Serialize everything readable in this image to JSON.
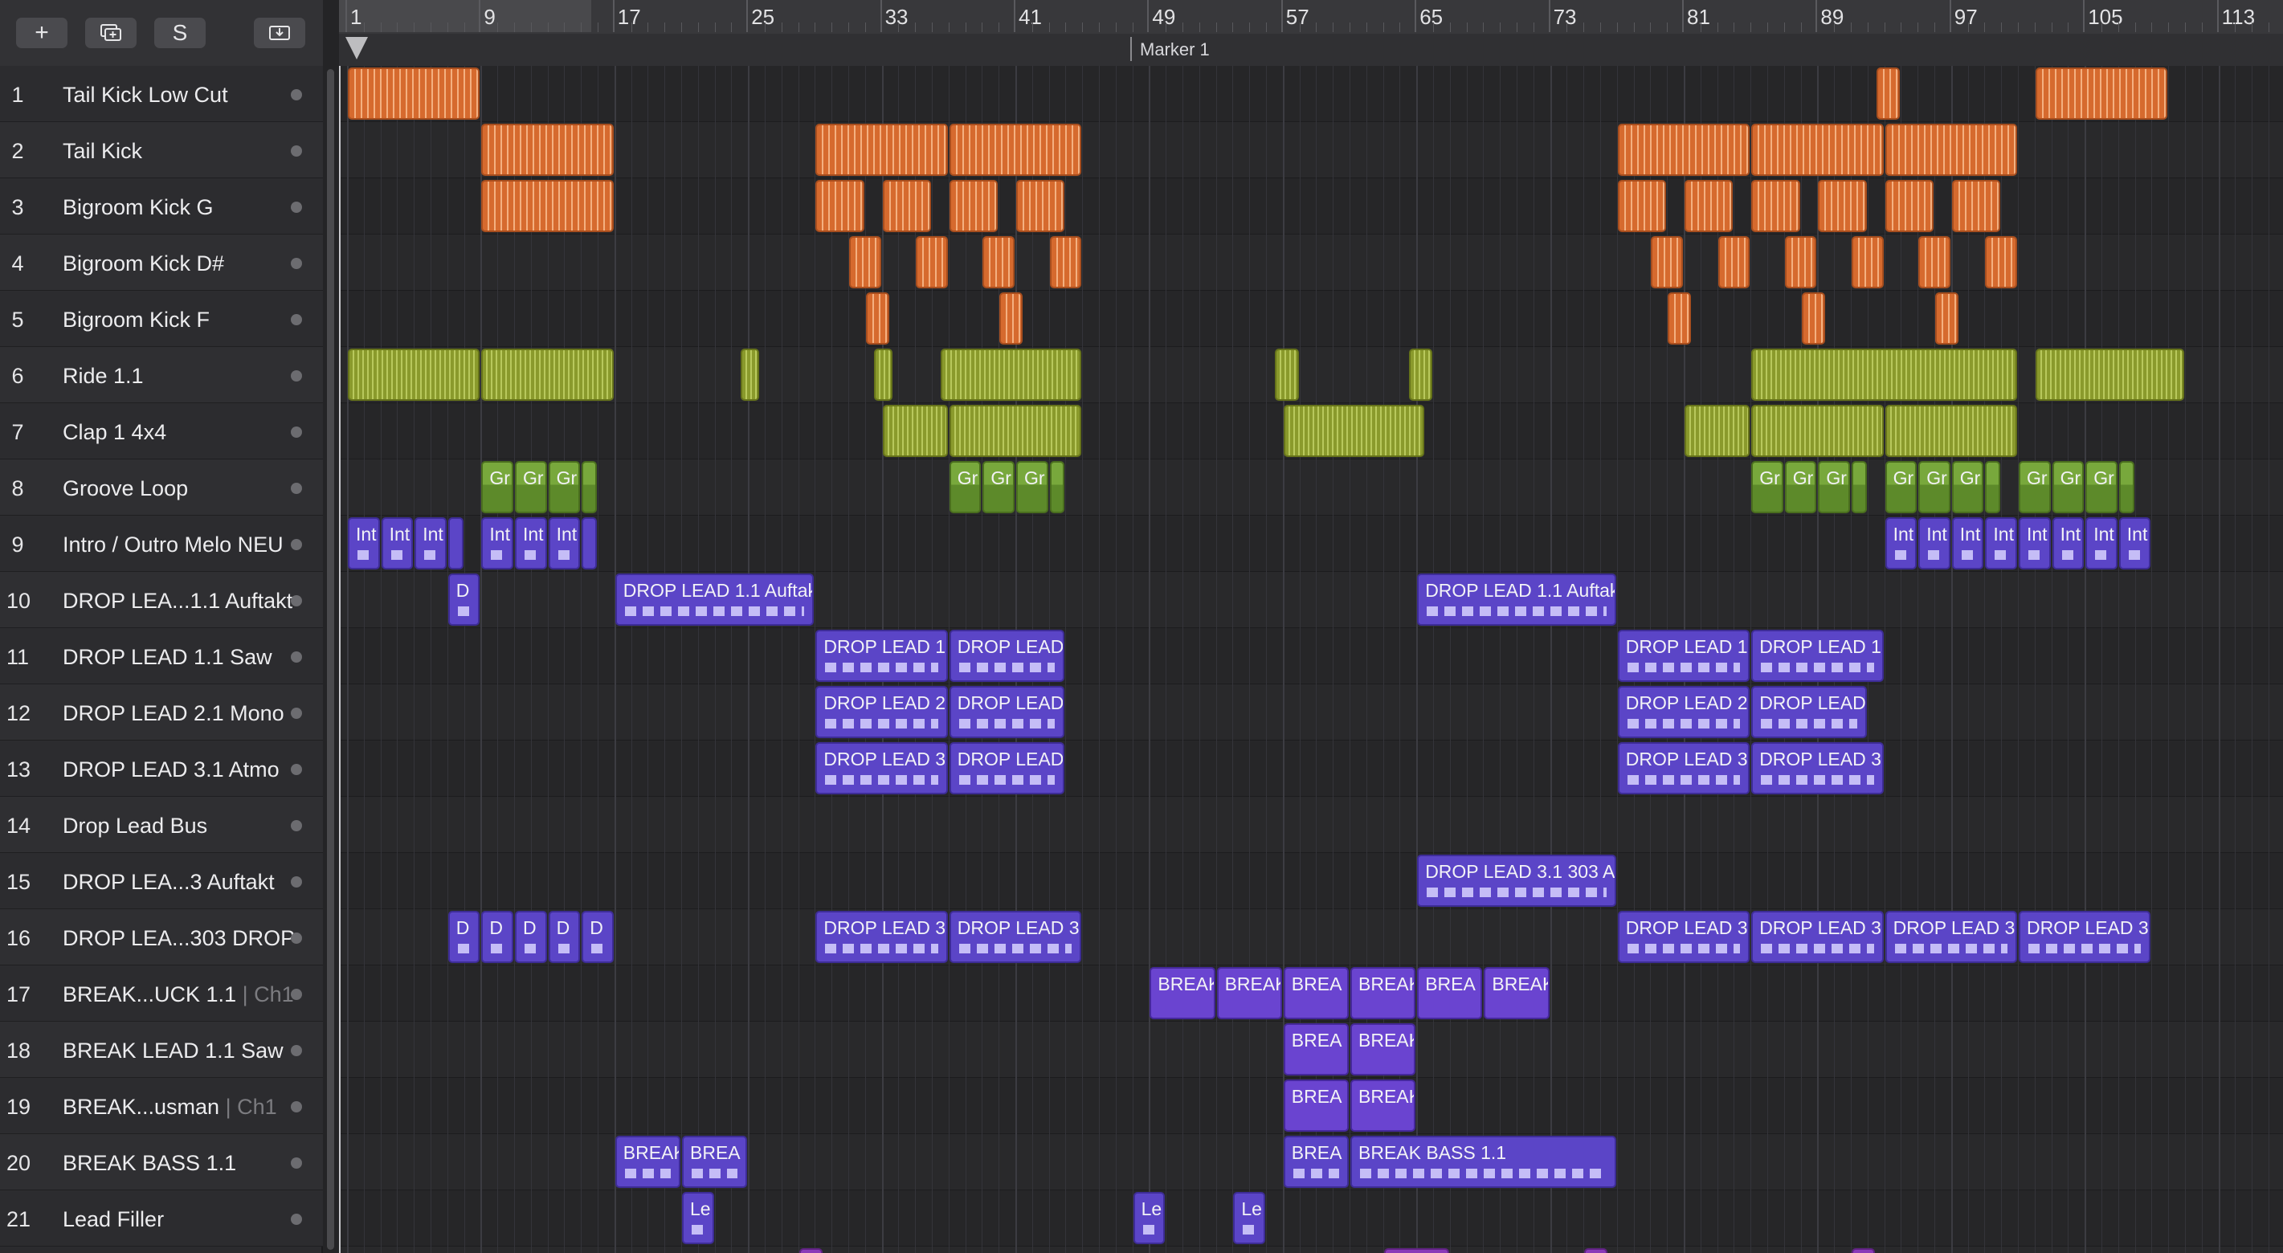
{
  "toolbar": {
    "add_track_icon": "plus-icon",
    "add_track_label": "+",
    "duplicate_icon": "duplicate-track-icon",
    "solo_label": "S",
    "download_icon": "download-icon"
  },
  "ruler": {
    "bars": [
      "1",
      "9",
      "17",
      "25",
      "33",
      "41",
      "49",
      "57",
      "65",
      "73",
      "81",
      "89",
      "97",
      "105",
      "113"
    ],
    "marker_label": "Marker 1"
  },
  "tracks": [
    {
      "num": "1",
      "name": "Tail Kick Low Cut",
      "chan": ""
    },
    {
      "num": "2",
      "name": "Tail Kick",
      "chan": ""
    },
    {
      "num": "3",
      "name": "Bigroom Kick G",
      "chan": ""
    },
    {
      "num": "4",
      "name": "Bigroom Kick D#",
      "chan": ""
    },
    {
      "num": "5",
      "name": "Bigroom Kick F",
      "chan": ""
    },
    {
      "num": "6",
      "name": "Ride 1.1",
      "chan": ""
    },
    {
      "num": "7",
      "name": "Clap 1 4x4",
      "chan": ""
    },
    {
      "num": "8",
      "name": "Groove Loop",
      "chan": ""
    },
    {
      "num": "9",
      "name": "Intro / Outro Melo NEU",
      "chan": ""
    },
    {
      "num": "10",
      "name": "DROP LEA...1.1 Auftakt",
      "chan": ""
    },
    {
      "num": "11",
      "name": "DROP LEAD 1.1 Saw",
      "chan": ""
    },
    {
      "num": "12",
      "name": "DROP LEAD 2.1 Mono",
      "chan": ""
    },
    {
      "num": "13",
      "name": "DROP LEAD 3.1 Atmo",
      "chan": ""
    },
    {
      "num": "14",
      "name": "Drop Lead Bus",
      "chan": ""
    },
    {
      "num": "15",
      "name": "DROP LEA...3 Auftakt",
      "chan": ""
    },
    {
      "num": "16",
      "name": "DROP LEA...303 DROP",
      "chan": ""
    },
    {
      "num": "17",
      "name": "BREAK...UCK 1.1",
      "chan": " | Ch1"
    },
    {
      "num": "18",
      "name": "BREAK LEAD 1.1 Saw",
      "chan": ""
    },
    {
      "num": "19",
      "name": "BREAK...usman",
      "chan": " | Ch1"
    },
    {
      "num": "20",
      "name": "BREAK BASS 1.1",
      "chan": ""
    },
    {
      "num": "21",
      "name": "Lead Filler",
      "chan": ""
    }
  ],
  "regions": [
    {
      "track": 0,
      "bar": 1,
      "len": 8,
      "style": "orange",
      "label": ""
    },
    {
      "track": 0,
      "bar": 92.5,
      "len": 1.5,
      "style": "orange",
      "label": ""
    },
    {
      "track": 0,
      "bar": 102,
      "len": 8,
      "style": "orange",
      "label": ""
    },
    {
      "track": 1,
      "bar": 9,
      "len": 8,
      "style": "orange",
      "label": ""
    },
    {
      "track": 1,
      "bar": 29,
      "len": 8,
      "style": "orange",
      "label": ""
    },
    {
      "track": 1,
      "bar": 37,
      "len": 8,
      "style": "orange",
      "label": ""
    },
    {
      "track": 1,
      "bar": 77,
      "len": 8,
      "style": "orange",
      "label": ""
    },
    {
      "track": 1,
      "bar": 85,
      "len": 8,
      "style": "orange",
      "label": ""
    },
    {
      "track": 1,
      "bar": 93,
      "len": 8,
      "style": "orange",
      "label": ""
    },
    {
      "track": 2,
      "bar": 9,
      "len": 8,
      "style": "orange",
      "label": ""
    },
    {
      "track": 2,
      "bar": 29,
      "len": 3,
      "style": "orange",
      "label": ""
    },
    {
      "track": 2,
      "bar": 33,
      "len": 3,
      "style": "orange",
      "label": ""
    },
    {
      "track": 2,
      "bar": 37,
      "len": 3,
      "style": "orange",
      "label": ""
    },
    {
      "track": 2,
      "bar": 41,
      "len": 3,
      "style": "orange",
      "label": ""
    },
    {
      "track": 2,
      "bar": 77,
      "len": 3,
      "style": "orange",
      "label": ""
    },
    {
      "track": 2,
      "bar": 81,
      "len": 3,
      "style": "orange",
      "label": ""
    },
    {
      "track": 2,
      "bar": 85,
      "len": 3,
      "style": "orange",
      "label": ""
    },
    {
      "track": 2,
      "bar": 89,
      "len": 3,
      "style": "orange",
      "label": ""
    },
    {
      "track": 2,
      "bar": 93,
      "len": 3,
      "style": "orange",
      "label": ""
    },
    {
      "track": 2,
      "bar": 97,
      "len": 3,
      "style": "orange",
      "label": ""
    },
    {
      "track": 3,
      "bar": 31,
      "len": 2,
      "style": "orange",
      "label": ""
    },
    {
      "track": 3,
      "bar": 35,
      "len": 2,
      "style": "orange",
      "label": ""
    },
    {
      "track": 3,
      "bar": 39,
      "len": 2,
      "style": "orange",
      "label": ""
    },
    {
      "track": 3,
      "bar": 43,
      "len": 2,
      "style": "orange",
      "label": ""
    },
    {
      "track": 3,
      "bar": 79,
      "len": 2,
      "style": "orange",
      "label": ""
    },
    {
      "track": 3,
      "bar": 83,
      "len": 2,
      "style": "orange",
      "label": ""
    },
    {
      "track": 3,
      "bar": 87,
      "len": 2,
      "style": "orange",
      "label": ""
    },
    {
      "track": 3,
      "bar": 91,
      "len": 2,
      "style": "orange",
      "label": ""
    },
    {
      "track": 3,
      "bar": 95,
      "len": 2,
      "style": "orange",
      "label": ""
    },
    {
      "track": 3,
      "bar": 99,
      "len": 2,
      "style": "orange",
      "label": ""
    },
    {
      "track": 4,
      "bar": 32,
      "len": 1.5,
      "style": "orange",
      "label": ""
    },
    {
      "track": 4,
      "bar": 40,
      "len": 1.5,
      "style": "orange",
      "label": ""
    },
    {
      "track": 4,
      "bar": 80,
      "len": 1.5,
      "style": "orange",
      "label": ""
    },
    {
      "track": 4,
      "bar": 88,
      "len": 1.5,
      "style": "orange",
      "label": ""
    },
    {
      "track": 4,
      "bar": 96,
      "len": 1.5,
      "style": "orange",
      "label": ""
    },
    {
      "track": 5,
      "bar": 1,
      "len": 8,
      "style": "olive",
      "label": ""
    },
    {
      "track": 5,
      "bar": 9,
      "len": 8,
      "style": "olive",
      "label": ""
    },
    {
      "track": 5,
      "bar": 24.5,
      "len": 1.2,
      "style": "olive",
      "label": ""
    },
    {
      "track": 5,
      "bar": 32.5,
      "len": 1.2,
      "style": "olive",
      "label": ""
    },
    {
      "track": 5,
      "bar": 36.5,
      "len": 8.5,
      "style": "olive",
      "label": ""
    },
    {
      "track": 5,
      "bar": 56.5,
      "len": 1.5,
      "style": "olive",
      "label": ""
    },
    {
      "track": 5,
      "bar": 64.5,
      "len": 1.5,
      "style": "olive",
      "label": ""
    },
    {
      "track": 5,
      "bar": 85,
      "len": 16,
      "style": "olive",
      "label": ""
    },
    {
      "track": 5,
      "bar": 102,
      "len": 9,
      "style": "olive",
      "label": ""
    },
    {
      "track": 6,
      "bar": 33,
      "len": 4,
      "style": "olive",
      "label": ""
    },
    {
      "track": 6,
      "bar": 37,
      "len": 8,
      "style": "olive",
      "label": ""
    },
    {
      "track": 6,
      "bar": 57,
      "len": 8.5,
      "style": "olive",
      "label": ""
    },
    {
      "track": 6,
      "bar": 81,
      "len": 4,
      "style": "olive",
      "label": ""
    },
    {
      "track": 6,
      "bar": 85,
      "len": 8,
      "style": "olive",
      "label": ""
    },
    {
      "track": 6,
      "bar": 93,
      "len": 8,
      "style": "olive",
      "label": ""
    },
    {
      "track": 7,
      "bar": 9,
      "len": 2,
      "style": "green",
      "label": "Gr"
    },
    {
      "track": 7,
      "bar": 11,
      "len": 2,
      "style": "green",
      "label": "Gr"
    },
    {
      "track": 7,
      "bar": 13,
      "len": 2,
      "style": "green",
      "label": "Gr"
    },
    {
      "track": 7,
      "bar": 15,
      "len": 1,
      "style": "green",
      "label": ""
    },
    {
      "track": 7,
      "bar": 37,
      "len": 2,
      "style": "green",
      "label": "Gr"
    },
    {
      "track": 7,
      "bar": 39,
      "len": 2,
      "style": "green",
      "label": "Gr"
    },
    {
      "track": 7,
      "bar": 41,
      "len": 2,
      "style": "green",
      "label": "Gr"
    },
    {
      "track": 7,
      "bar": 43,
      "len": 1,
      "style": "green",
      "label": ""
    },
    {
      "track": 7,
      "bar": 85,
      "len": 2,
      "style": "green",
      "label": "Gr"
    },
    {
      "track": 7,
      "bar": 87,
      "len": 2,
      "style": "green",
      "label": "Gr"
    },
    {
      "track": 7,
      "bar": 89,
      "len": 2,
      "style": "green",
      "label": "Gr"
    },
    {
      "track": 7,
      "bar": 91,
      "len": 1,
      "style": "green",
      "label": ""
    },
    {
      "track": 7,
      "bar": 93,
      "len": 2,
      "style": "green",
      "label": "Gr"
    },
    {
      "track": 7,
      "bar": 95,
      "len": 2,
      "style": "green",
      "label": "Gr"
    },
    {
      "track": 7,
      "bar": 97,
      "len": 2,
      "style": "green",
      "label": "Gr"
    },
    {
      "track": 7,
      "bar": 99,
      "len": 1,
      "style": "green",
      "label": ""
    },
    {
      "track": 7,
      "bar": 101,
      "len": 2,
      "style": "green",
      "label": "Gr"
    },
    {
      "track": 7,
      "bar": 103,
      "len": 2,
      "style": "green",
      "label": "Gr"
    },
    {
      "track": 7,
      "bar": 105,
      "len": 2,
      "style": "green",
      "label": "Gr"
    },
    {
      "track": 7,
      "bar": 107,
      "len": 1,
      "style": "green",
      "label": ""
    },
    {
      "track": 8,
      "bar": 1,
      "len": 2,
      "style": "purple",
      "label": "Int"
    },
    {
      "track": 8,
      "bar": 3,
      "len": 2,
      "style": "purple",
      "label": "Int"
    },
    {
      "track": 8,
      "bar": 5,
      "len": 2,
      "style": "purple",
      "label": "Int"
    },
    {
      "track": 8,
      "bar": 7,
      "len": 1,
      "style": "purple",
      "label": ""
    },
    {
      "track": 8,
      "bar": 9,
      "len": 2,
      "style": "purple",
      "label": "Int"
    },
    {
      "track": 8,
      "bar": 11,
      "len": 2,
      "style": "purple",
      "label": "Int"
    },
    {
      "track": 8,
      "bar": 13,
      "len": 2,
      "style": "purple",
      "label": "Int"
    },
    {
      "track": 8,
      "bar": 15,
      "len": 1,
      "style": "purple",
      "label": ""
    },
    {
      "track": 8,
      "bar": 93,
      "len": 2,
      "style": "purple",
      "label": "Int"
    },
    {
      "track": 8,
      "bar": 95,
      "len": 2,
      "style": "purple",
      "label": "Int"
    },
    {
      "track": 8,
      "bar": 97,
      "len": 2,
      "style": "purple",
      "label": "Int"
    },
    {
      "track": 8,
      "bar": 99,
      "len": 2,
      "style": "purple",
      "label": "Int"
    },
    {
      "track": 8,
      "bar": 101,
      "len": 2,
      "style": "purple",
      "label": "Int"
    },
    {
      "track": 8,
      "bar": 103,
      "len": 2,
      "style": "purple",
      "label": "Int"
    },
    {
      "track": 8,
      "bar": 105,
      "len": 2,
      "style": "purple",
      "label": "Int"
    },
    {
      "track": 8,
      "bar": 107,
      "len": 2,
      "style": "purple",
      "label": "Int"
    },
    {
      "track": 9,
      "bar": 7,
      "len": 2,
      "style": "purple",
      "label": "D"
    },
    {
      "track": 9,
      "bar": 17,
      "len": 12,
      "style": "purple",
      "label": "DROP LEAD 1.1 Auftak"
    },
    {
      "track": 9,
      "bar": 65,
      "len": 12,
      "style": "purple",
      "label": "DROP LEAD 1.1 Auftak"
    },
    {
      "track": 10,
      "bar": 29,
      "len": 8,
      "style": "purple",
      "label": "DROP LEAD 1."
    },
    {
      "track": 10,
      "bar": 37,
      "len": 7,
      "style": "purple",
      "label": "DROP LEAD"
    },
    {
      "track": 10,
      "bar": 77,
      "len": 8,
      "style": "purple",
      "label": "DROP LEAD 1."
    },
    {
      "track": 10,
      "bar": 85,
      "len": 8,
      "style": "purple",
      "label": "DROP LEAD 1."
    },
    {
      "track": 11,
      "bar": 29,
      "len": 8,
      "style": "purple",
      "label": "DROP LEAD 2."
    },
    {
      "track": 11,
      "bar": 37,
      "len": 7,
      "style": "purple",
      "label": "DROP LEAD"
    },
    {
      "track": 11,
      "bar": 77,
      "len": 8,
      "style": "purple",
      "label": "DROP LEAD 2."
    },
    {
      "track": 11,
      "bar": 85,
      "len": 7,
      "style": "purple",
      "label": "DROP LEAD"
    },
    {
      "track": 12,
      "bar": 29,
      "len": 8,
      "style": "purple",
      "label": "DROP LEAD 3."
    },
    {
      "track": 12,
      "bar": 37,
      "len": 7,
      "style": "purple",
      "label": "DROP LEAD"
    },
    {
      "track": 12,
      "bar": 77,
      "len": 8,
      "style": "purple",
      "label": "DROP LEAD 3."
    },
    {
      "track": 12,
      "bar": 85,
      "len": 8,
      "style": "purple",
      "label": "DROP LEAD 3."
    },
    {
      "track": 14,
      "bar": 65,
      "len": 12,
      "style": "purple",
      "label": "DROP LEAD 3.1 303 A"
    },
    {
      "track": 15,
      "bar": 7,
      "len": 2,
      "style": "purple",
      "label": "D"
    },
    {
      "track": 15,
      "bar": 9,
      "len": 2,
      "style": "purple",
      "label": "D"
    },
    {
      "track": 15,
      "bar": 11,
      "len": 2,
      "style": "purple",
      "label": "D"
    },
    {
      "track": 15,
      "bar": 13,
      "len": 2,
      "style": "purple",
      "label": "D"
    },
    {
      "track": 15,
      "bar": 15,
      "len": 2,
      "style": "purple",
      "label": "D"
    },
    {
      "track": 15,
      "bar": 29,
      "len": 8,
      "style": "purple",
      "label": "DROP LEAD 3."
    },
    {
      "track": 15,
      "bar": 37,
      "len": 8,
      "style": "purple",
      "label": "DROP LEAD 3."
    },
    {
      "track": 15,
      "bar": 77,
      "len": 8,
      "style": "purple",
      "label": "DROP LEAD 3."
    },
    {
      "track": 15,
      "bar": 85,
      "len": 8,
      "style": "purple",
      "label": "DROP LEAD 3."
    },
    {
      "track": 15,
      "bar": 93,
      "len": 8,
      "style": "purple",
      "label": "DROP LEAD 3."
    },
    {
      "track": 15,
      "bar": 101,
      "len": 8,
      "style": "purple",
      "label": "DROP LEAD 3."
    },
    {
      "track": 16,
      "bar": 49,
      "len": 4,
      "style": "breaklead",
      "label": "BREAK"
    },
    {
      "track": 16,
      "bar": 53,
      "len": 4,
      "style": "breaklead",
      "label": "BREAK"
    },
    {
      "track": 16,
      "bar": 57,
      "len": 4,
      "style": "breaklead",
      "label": "BREA"
    },
    {
      "track": 16,
      "bar": 61,
      "len": 4,
      "style": "breaklead",
      "label": "BREAK"
    },
    {
      "track": 16,
      "bar": 65,
      "len": 4,
      "style": "breaklead",
      "label": "BREA"
    },
    {
      "track": 16,
      "bar": 69,
      "len": 4,
      "style": "breaklead",
      "label": "BREAK"
    },
    {
      "track": 17,
      "bar": 57,
      "len": 4,
      "style": "breaklead",
      "label": "BREA"
    },
    {
      "track": 17,
      "bar": 61,
      "len": 4,
      "style": "breaklead",
      "label": "BREAK"
    },
    {
      "track": 18,
      "bar": 57,
      "len": 4,
      "style": "breaklead",
      "label": "BREA"
    },
    {
      "track": 18,
      "bar": 61,
      "len": 4,
      "style": "breaklead",
      "label": "BREAK"
    },
    {
      "track": 19,
      "bar": 17,
      "len": 4,
      "style": "purple",
      "label": "BREAK"
    },
    {
      "track": 19,
      "bar": 21,
      "len": 4,
      "style": "purple",
      "label": "BREA"
    },
    {
      "track": 19,
      "bar": 57,
      "len": 4,
      "style": "purple",
      "label": "BREA"
    },
    {
      "track": 19,
      "bar": 61,
      "len": 16,
      "style": "purple",
      "label": "BREAK BASS 1.1"
    },
    {
      "track": 20,
      "bar": 21,
      "len": 2,
      "style": "purple",
      "label": "Le"
    },
    {
      "track": 20,
      "bar": 48,
      "len": 2,
      "style": "purple",
      "label": "Le"
    },
    {
      "track": 20,
      "bar": 54,
      "len": 2,
      "style": "purple",
      "label": "Le"
    },
    {
      "track": 21,
      "bar": 28,
      "len": 1.5,
      "style": "magenta",
      "label": ""
    },
    {
      "track": 21,
      "bar": 63,
      "len": 4,
      "style": "magenta",
      "label": ""
    },
    {
      "track": 21,
      "bar": 75,
      "len": 1.5,
      "style": "magenta",
      "label": ""
    },
    {
      "track": 21,
      "bar": 91,
      "len": 1.5,
      "style": "magenta",
      "label": ""
    }
  ],
  "colors": {
    "orange": "#d66a2e",
    "olive": "#8a9a2c",
    "green": "#78a83c",
    "purple": "#5b45c7",
    "magenta": "#8a3ab8"
  }
}
